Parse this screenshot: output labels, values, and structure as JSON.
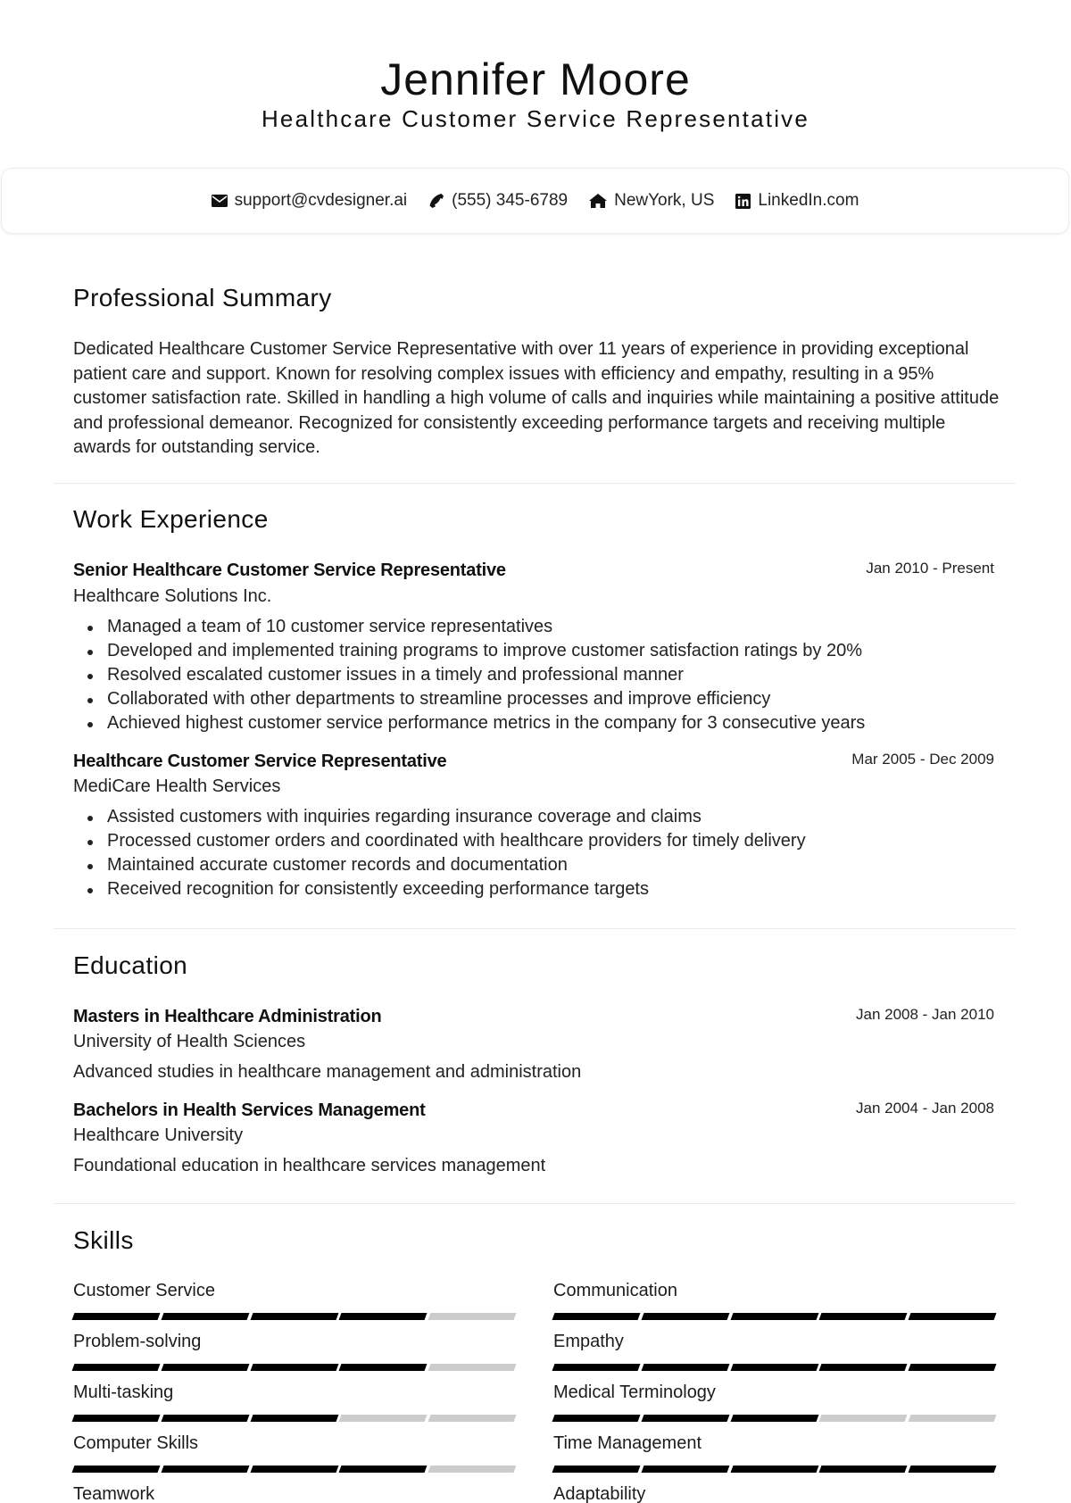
{
  "header": {
    "name": "Jennifer Moore",
    "title": "Healthcare Customer Service Representative"
  },
  "contact": [
    {
      "icon": "envelope-icon",
      "text": "support@cvdesigner.ai"
    },
    {
      "icon": "phone-icon",
      "text": "(555) 345-6789"
    },
    {
      "icon": "home-icon",
      "text": "NewYork, US"
    },
    {
      "icon": "linkedin-icon",
      "text": "LinkedIn.com"
    }
  ],
  "summary": {
    "heading": "Professional Summary",
    "text": "Dedicated Healthcare Customer Service Representative with over 11 years of experience in providing exceptional patient care and support. Known for resolving complex issues with efficiency and empathy, resulting in a 95% customer satisfaction rate. Skilled in handling a high volume of calls and inquiries while maintaining a positive attitude and professional demeanor. Recognized for consistently exceeding performance targets and receiving multiple awards for outstanding service."
  },
  "experience": {
    "heading": "Work Experience",
    "jobs": [
      {
        "title": "Senior Healthcare Customer Service Representative",
        "company": "Healthcare Solutions Inc.",
        "dates": "Jan 2010 - Present",
        "bullets": [
          "Managed a team of 10 customer service representatives",
          "Developed and implemented training programs to improve customer satisfaction ratings by 20%",
          "Resolved escalated customer issues in a timely and professional manner",
          "Collaborated with other departments to streamline processes and improve efficiency",
          "Achieved highest customer service performance metrics in the company for 3 consecutive years"
        ]
      },
      {
        "title": "Healthcare Customer Service Representative",
        "company": "MediCare Health Services",
        "dates": "Mar 2005 - Dec 2009",
        "bullets": [
          "Assisted customers with inquiries regarding insurance coverage and claims",
          "Processed customer orders and coordinated with healthcare providers for timely delivery",
          "Maintained accurate customer records and documentation",
          "Received recognition for consistently exceeding performance targets"
        ]
      }
    ]
  },
  "education": {
    "heading": "Education",
    "items": [
      {
        "degree": "Masters in Healthcare Administration",
        "school": "University of Health Sciences",
        "dates": "Jan 2008 - Jan 2010",
        "description": "Advanced studies in healthcare management and administration"
      },
      {
        "degree": "Bachelors in Health Services Management",
        "school": "Healthcare University",
        "dates": "Jan 2004 - Jan 2008",
        "description": "Foundational education in healthcare services management"
      }
    ]
  },
  "skills": {
    "heading": "Skills",
    "max_level": 5,
    "items": [
      {
        "name": "Customer Service",
        "level": 4
      },
      {
        "name": "Communication",
        "level": 5
      },
      {
        "name": "Problem-solving",
        "level": 4
      },
      {
        "name": "Empathy",
        "level": 5
      },
      {
        "name": "Multi-tasking",
        "level": 3
      },
      {
        "name": "Medical Terminology",
        "level": 3
      },
      {
        "name": "Computer Skills",
        "level": 4
      },
      {
        "name": "Time Management",
        "level": 5
      },
      {
        "name": "Teamwork",
        "level": null
      },
      {
        "name": "Adaptability",
        "level": null
      }
    ]
  },
  "colors": {
    "bar_filled": "#000000",
    "bar_empty": "#cccccc",
    "divider": "#ebebeb"
  }
}
